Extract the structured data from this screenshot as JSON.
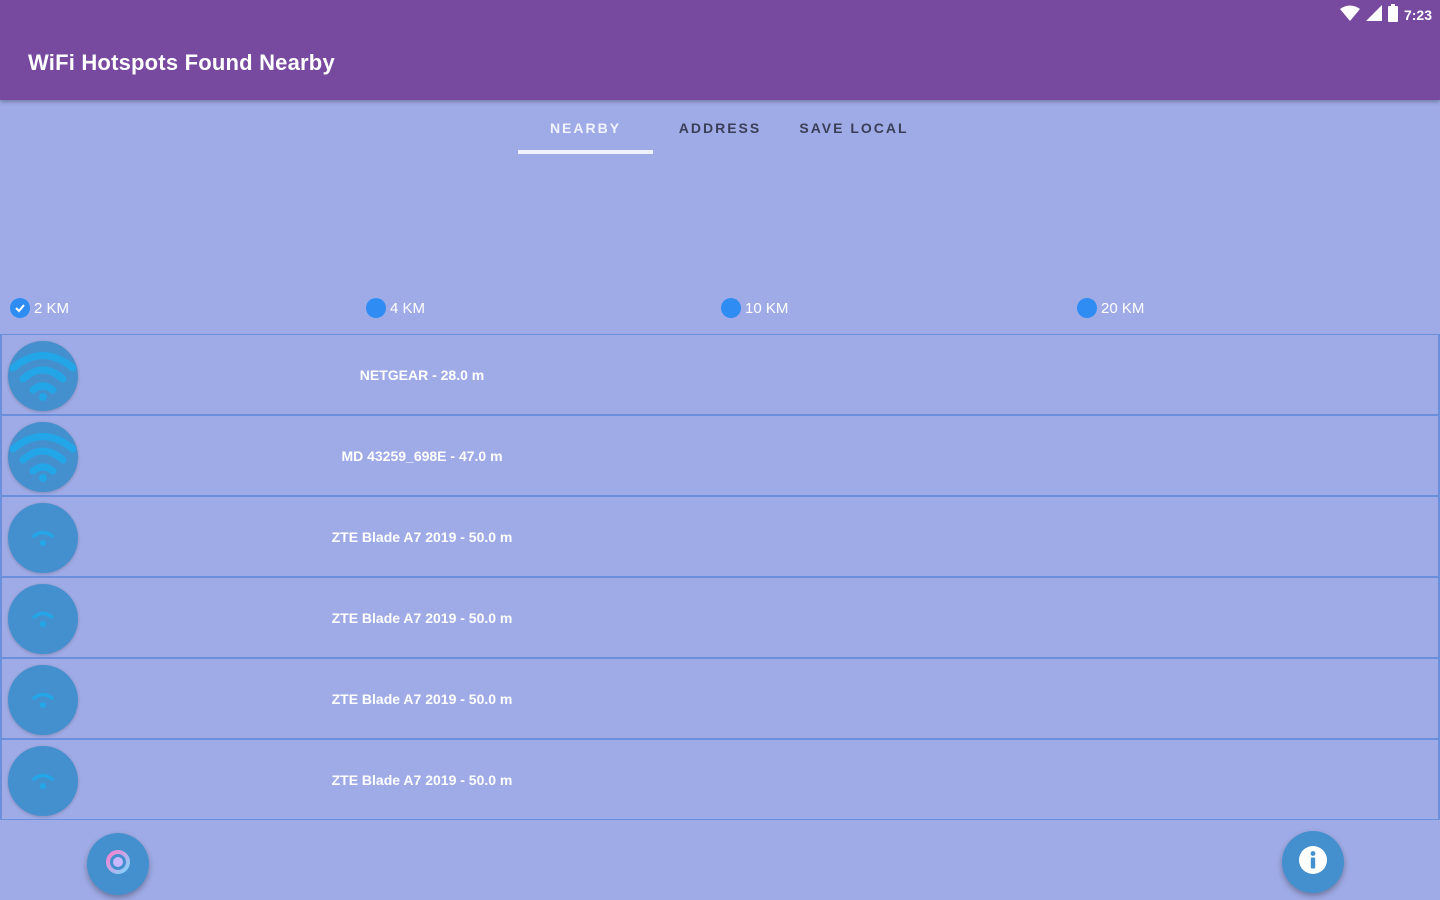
{
  "status_bar": {
    "time": "7:23",
    "icons": [
      "wifi-signal-icon",
      "cell-signal-icon",
      "battery-icon"
    ]
  },
  "app_bar": {
    "title": "WiFi Hotspots Found Nearby"
  },
  "tabs": [
    {
      "label": "NEARBY",
      "active": true
    },
    {
      "label": "ADDRESS",
      "active": false
    },
    {
      "label": "SAVE LOCAL",
      "active": false
    }
  ],
  "radius_options": [
    {
      "label": "2 KM",
      "selected": true
    },
    {
      "label": "4 KM",
      "selected": false
    },
    {
      "label": "10 KM",
      "selected": false
    },
    {
      "label": "20 KM",
      "selected": false
    }
  ],
  "hotspots": [
    {
      "label": "NETGEAR - 28.0 m",
      "signal": "strong"
    },
    {
      "label": "MD 43259_698E - 47.0 m",
      "signal": "strong"
    },
    {
      "label": "ZTE Blade A7 2019 - 50.0 m",
      "signal": "weak"
    },
    {
      "label": "ZTE Blade A7 2019 - 50.0 m",
      "signal": "weak"
    },
    {
      "label": "ZTE Blade A7 2019 - 50.0 m",
      "signal": "weak"
    },
    {
      "label": "ZTE Blade A7 2019 - 50.0 m",
      "signal": "weak"
    }
  ],
  "fabs": {
    "left_icon": "refresh-icon",
    "right_icon": "info-icon"
  },
  "colors": {
    "app_bar": "#77499f",
    "background": "#9fabe6",
    "accent": "#2f8cf3",
    "avatar": "#4490ce",
    "wifi_icon": "#22a6e8"
  }
}
